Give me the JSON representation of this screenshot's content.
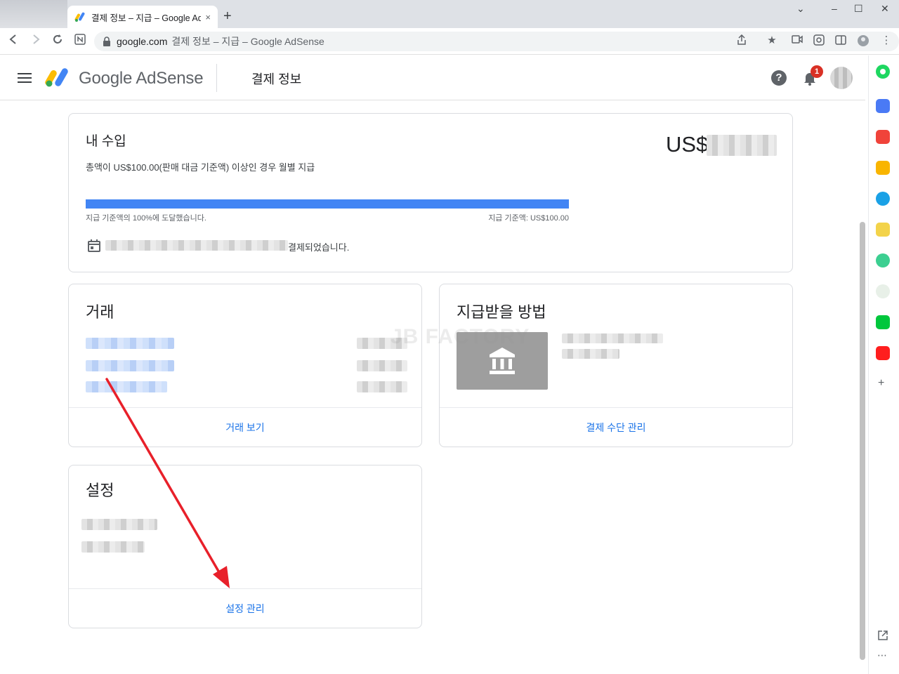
{
  "browser": {
    "tab_title": "결제 정보 – 지급 – Google AdSense",
    "tab_close": "×",
    "new_tab": "+",
    "address_domain": "google.com",
    "address_path": "결제 정보 – 지급 – Google AdSense",
    "window_controls": [
      "⌄",
      "–",
      "☐",
      "✕"
    ]
  },
  "header": {
    "brand": "Google AdSense",
    "page_title": "결제 정보",
    "help": "?",
    "notification_count": "1"
  },
  "earnings": {
    "title": "내 수입",
    "subtitle": "총액이 US$100.00(판매 대금 기준액) 이상인 경우 월별 지급",
    "amount_prefix": "US$",
    "progress_percent": 100,
    "progress_left": "지급 기준액의 100%에 도달했습니다.",
    "progress_right": "지급 기준액: US$100.00",
    "payment_status_suffix": "결제되었습니다."
  },
  "transactions": {
    "title": "거래",
    "link": "거래 보기"
  },
  "payment_method": {
    "title": "지급받을 방법",
    "link": "결제 수단 관리"
  },
  "settings": {
    "title": "설정",
    "link": "설정 관리"
  },
  "watermark": "JB FACTORY",
  "colors": {
    "accent": "#1a73e8",
    "progress": "#4285f4",
    "arrow": "#e8202a",
    "badge": "#d93025"
  }
}
